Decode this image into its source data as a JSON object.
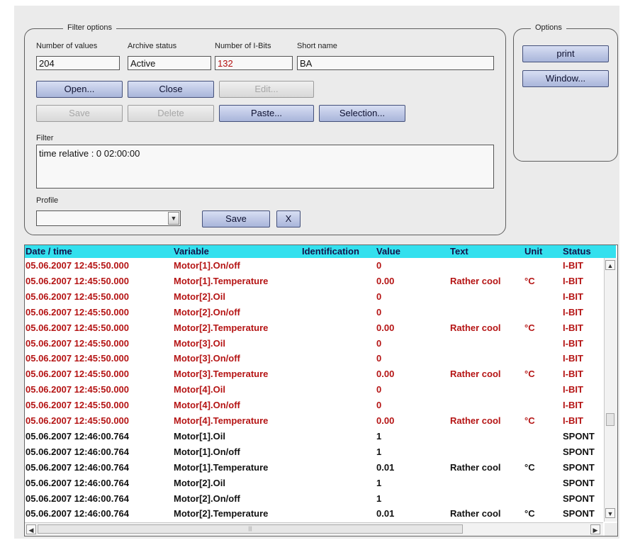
{
  "filter_options": {
    "legend": "Filter options",
    "number_of_values": {
      "label": "Number of values",
      "value": "204"
    },
    "archive_status": {
      "label": "Archive status",
      "value": "Active"
    },
    "number_of_ibits": {
      "label": "Number of I-Bits",
      "value": "132"
    },
    "short_name": {
      "label": "Short name",
      "value": "BA"
    },
    "buttons": {
      "open": "Open...",
      "close": "Close",
      "edit": "Edit...",
      "save": "Save",
      "delete": "Delete",
      "paste": "Paste...",
      "selection": "Selection..."
    },
    "filter": {
      "label": "Filter",
      "value": "time relative : 0  02:00:00"
    },
    "profile": {
      "label": "Profile",
      "value": "",
      "save_label": "Save",
      "clear_label": "X"
    }
  },
  "options": {
    "legend": "Options",
    "print_label": "print",
    "window_label": "Window..."
  },
  "table": {
    "columns": [
      "Date / time",
      "Variable",
      "Identification",
      "Value",
      "Text",
      "Unit",
      "Status"
    ],
    "rows": [
      {
        "datetime": "05.06.2007 12:45:50.000",
        "variable": "Motor[1].On/off",
        "identification": "",
        "value": "0",
        "text": "",
        "unit": "",
        "status": "I-BIT"
      },
      {
        "datetime": "05.06.2007 12:45:50.000",
        "variable": "Motor[1].Temperature",
        "identification": "",
        "value": "0.00",
        "text": "Rather cool",
        "unit": "°C",
        "status": "I-BIT"
      },
      {
        "datetime": "05.06.2007 12:45:50.000",
        "variable": "Motor[2].Oil",
        "identification": "",
        "value": "0",
        "text": "",
        "unit": "",
        "status": "I-BIT"
      },
      {
        "datetime": "05.06.2007 12:45:50.000",
        "variable": "Motor[2].On/off",
        "identification": "",
        "value": "0",
        "text": "",
        "unit": "",
        "status": "I-BIT"
      },
      {
        "datetime": "05.06.2007 12:45:50.000",
        "variable": "Motor[2].Temperature",
        "identification": "",
        "value": "0.00",
        "text": "Rather cool",
        "unit": "°C",
        "status": "I-BIT"
      },
      {
        "datetime": "05.06.2007 12:45:50.000",
        "variable": "Motor[3].Oil",
        "identification": "",
        "value": "0",
        "text": "",
        "unit": "",
        "status": "I-BIT"
      },
      {
        "datetime": "05.06.2007 12:45:50.000",
        "variable": "Motor[3].On/off",
        "identification": "",
        "value": "0",
        "text": "",
        "unit": "",
        "status": "I-BIT"
      },
      {
        "datetime": "05.06.2007 12:45:50.000",
        "variable": "Motor[3].Temperature",
        "identification": "",
        "value": "0.00",
        "text": "Rather cool",
        "unit": "°C",
        "status": "I-BIT"
      },
      {
        "datetime": "05.06.2007 12:45:50.000",
        "variable": "Motor[4].Oil",
        "identification": "",
        "value": "0",
        "text": "",
        "unit": "",
        "status": "I-BIT"
      },
      {
        "datetime": "05.06.2007 12:45:50.000",
        "variable": "Motor[4].On/off",
        "identification": "",
        "value": "0",
        "text": "",
        "unit": "",
        "status": "I-BIT"
      },
      {
        "datetime": "05.06.2007 12:45:50.000",
        "variable": "Motor[4].Temperature",
        "identification": "",
        "value": "0.00",
        "text": "Rather cool",
        "unit": "°C",
        "status": "I-BIT"
      },
      {
        "datetime": "05.06.2007 12:46:00.764",
        "variable": "Motor[1].Oil",
        "identification": "",
        "value": "1",
        "text": "",
        "unit": "",
        "status": "SPONT"
      },
      {
        "datetime": "05.06.2007 12:46:00.764",
        "variable": "Motor[1].On/off",
        "identification": "",
        "value": "1",
        "text": "",
        "unit": "",
        "status": "SPONT"
      },
      {
        "datetime": "05.06.2007 12:46:00.764",
        "variable": "Motor[1].Temperature",
        "identification": "",
        "value": "0.01",
        "text": "Rather cool",
        "unit": "°C",
        "status": "SPONT"
      },
      {
        "datetime": "05.06.2007 12:46:00.764",
        "variable": "Motor[2].Oil",
        "identification": "",
        "value": "1",
        "text": "",
        "unit": "",
        "status": "SPONT"
      },
      {
        "datetime": "05.06.2007 12:46:00.764",
        "variable": "Motor[2].On/off",
        "identification": "",
        "value": "1",
        "text": "",
        "unit": "",
        "status": "SPONT"
      },
      {
        "datetime": "05.06.2007 12:46:00.764",
        "variable": "Motor[2].Temperature",
        "identification": "",
        "value": "0.01",
        "text": "Rather cool",
        "unit": "°C",
        "status": "SPONT"
      }
    ]
  },
  "icons": {
    "combo_arrow": "chevron-down-icon",
    "scroll_up": "triangle-up-icon",
    "scroll_down": "triangle-down-icon",
    "scroll_left": "triangle-left-icon",
    "scroll_right": "triangle-right-icon"
  },
  "colors": {
    "header_bg": "#33e0ee",
    "ibit_text": "#b51414",
    "spont_text": "#111111",
    "ibits_count_text": "#b30f0f",
    "button_face": "#b9c4e6"
  }
}
